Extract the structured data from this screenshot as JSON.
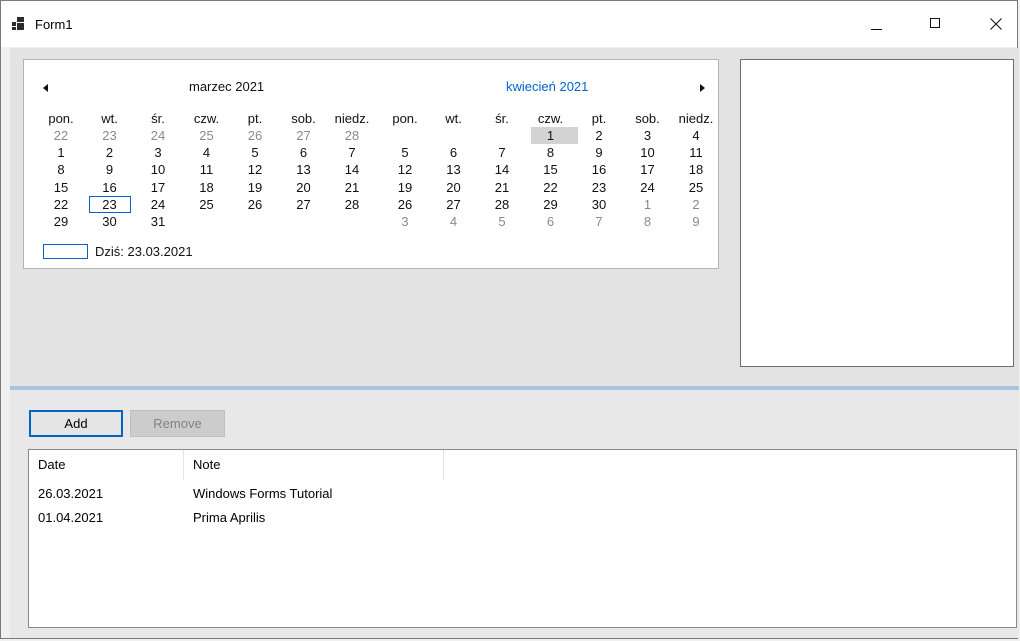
{
  "window": {
    "title": "Form1"
  },
  "calendar": {
    "left_month": {
      "title": "marzec 2021",
      "weekdays": [
        "pon.",
        "wt.",
        "śr.",
        "czw.",
        "pt.",
        "sob.",
        "niedz."
      ],
      "weeks": [
        [
          "22",
          "23",
          "24",
          "25",
          "26",
          "27",
          "28"
        ],
        [
          "1",
          "2",
          "3",
          "4",
          "5",
          "6",
          "7"
        ],
        [
          "8",
          "9",
          "10",
          "11",
          "12",
          "13",
          "14"
        ],
        [
          "15",
          "16",
          "17",
          "18",
          "19",
          "20",
          "21"
        ],
        [
          "22",
          "23",
          "24",
          "25",
          "26",
          "27",
          "28"
        ],
        [
          "29",
          "30",
          "31",
          "",
          "",
          "",
          ""
        ]
      ]
    },
    "right_month": {
      "title": "kwiecień 2021",
      "weekdays": [
        "pon.",
        "wt.",
        "śr.",
        "czw.",
        "pt.",
        "sob.",
        "niedz."
      ],
      "weeks": [
        [
          "",
          "",
          "",
          "1",
          "2",
          "3",
          "4"
        ],
        [
          "5",
          "6",
          "7",
          "8",
          "9",
          "10",
          "11"
        ],
        [
          "12",
          "13",
          "14",
          "15",
          "16",
          "17",
          "18"
        ],
        [
          "19",
          "20",
          "21",
          "22",
          "23",
          "24",
          "25"
        ],
        [
          "26",
          "27",
          "28",
          "29",
          "30",
          "1",
          "2"
        ],
        [
          "3",
          "4",
          "5",
          "6",
          "7",
          "8",
          "9"
        ]
      ]
    },
    "today_label": "Dziś: 23.03.2021",
    "accent_color": "#0066cc"
  },
  "buttons": {
    "add_label": "Add",
    "remove_label": "Remove"
  },
  "list": {
    "columns": [
      "Date",
      "Note"
    ],
    "rows": [
      [
        "26.03.2021",
        "Windows Forms Tutorial"
      ],
      [
        "01.04.2021",
        "Prima Aprilis"
      ]
    ]
  }
}
